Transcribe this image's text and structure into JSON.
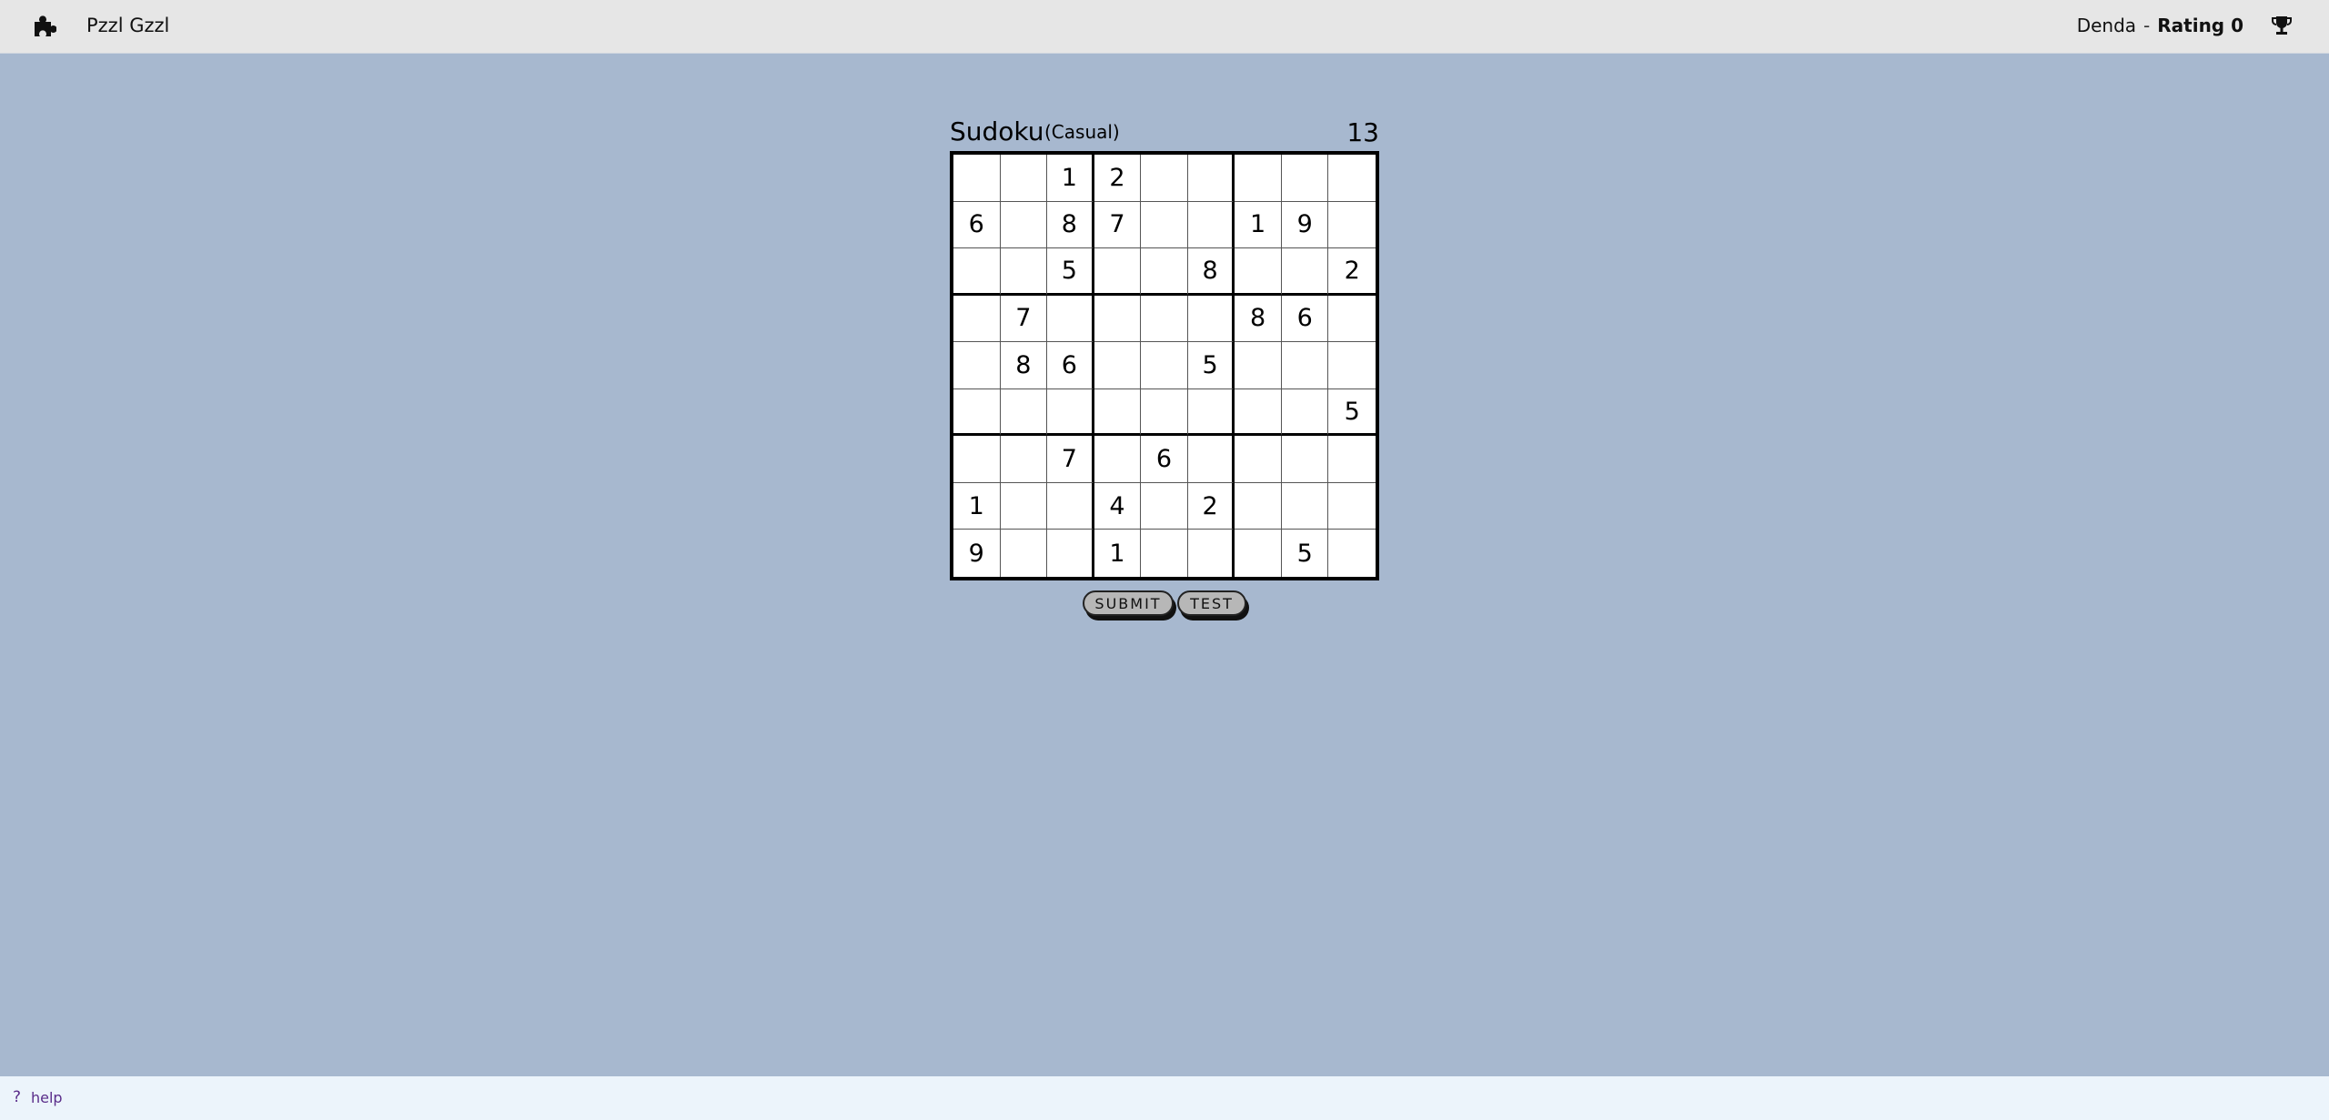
{
  "header": {
    "logo_icon": "puzzle-piece-icon",
    "brand": "Pzzl Gzzl",
    "username": "Denda",
    "separator": "-",
    "rating": "Rating 0",
    "trophy_icon": "trophy-icon"
  },
  "game": {
    "title": "Sudoku",
    "mode": "(Casual)",
    "counter": "13",
    "grid": [
      [
        "",
        "",
        "1",
        "2",
        "",
        "",
        "",
        "",
        ""
      ],
      [
        "6",
        "",
        "8",
        "7",
        "",
        "",
        "1",
        "9",
        ""
      ],
      [
        "",
        "",
        "5",
        "",
        "",
        "8",
        "",
        "",
        "2"
      ],
      [
        "",
        "7",
        "",
        "",
        "",
        "",
        "8",
        "6",
        ""
      ],
      [
        "",
        "8",
        "6",
        "",
        "",
        "5",
        "",
        "",
        ""
      ],
      [
        "",
        "",
        "",
        "",
        "",
        "",
        "",
        "",
        "5"
      ],
      [
        "",
        "",
        "7",
        "",
        "6",
        "",
        "",
        "",
        ""
      ],
      [
        "1",
        "",
        "",
        "4",
        "",
        "2",
        "",
        "",
        ""
      ],
      [
        "9",
        "",
        "",
        "1",
        "",
        "",
        "",
        "5",
        ""
      ]
    ]
  },
  "buttons": {
    "submit": "SUBMIT",
    "test": "TEST"
  },
  "footer": {
    "help_icon": "?",
    "help": "help"
  }
}
